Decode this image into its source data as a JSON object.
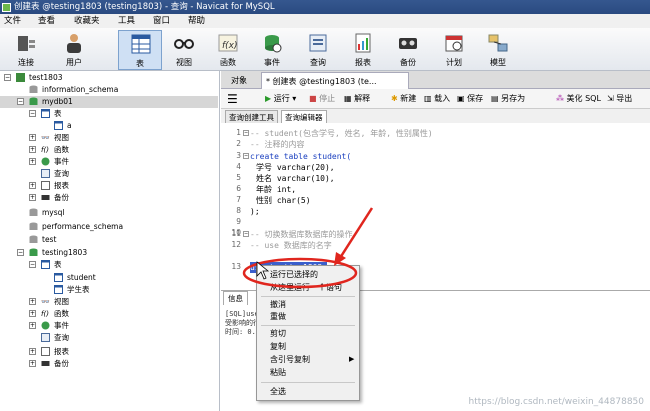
{
  "window": {
    "title": "创建表 @testing1803 (testing1803) - 查询 - Navicat for MySQL"
  },
  "menu": [
    "文件",
    "查看",
    "收藏夹",
    "工具",
    "窗口",
    "帮助"
  ],
  "toolbar": [
    {
      "label": "连接",
      "icon": "connection-icon"
    },
    {
      "label": "用户",
      "icon": "user-icon"
    },
    {
      "label": "表",
      "icon": "table-icon"
    },
    {
      "label": "视图",
      "icon": "view-icon"
    },
    {
      "label": "函数",
      "icon": "function-icon"
    },
    {
      "label": "事件",
      "icon": "event-icon"
    },
    {
      "label": "查询",
      "icon": "query-icon"
    },
    {
      "label": "报表",
      "icon": "report-icon"
    },
    {
      "label": "备份",
      "icon": "backup-icon"
    },
    {
      "label": "计划",
      "icon": "schedule-icon"
    },
    {
      "label": "模型",
      "icon": "model-icon"
    }
  ],
  "tree": [
    {
      "text": "test1803"
    },
    {
      "text": "information_schema"
    },
    {
      "text": "mydb01"
    },
    {
      "text": "表"
    },
    {
      "text": "a"
    },
    {
      "text": "视图"
    },
    {
      "text": "函数"
    },
    {
      "text": "事件"
    },
    {
      "text": "查询"
    },
    {
      "text": "报表"
    },
    {
      "text": "备份"
    },
    {
      "text": "mysql"
    },
    {
      "text": "performance_schema"
    },
    {
      "text": "test"
    },
    {
      "text": "testing1803"
    },
    {
      "text": "表"
    },
    {
      "text": "student"
    },
    {
      "text": "学生表"
    },
    {
      "text": "视图"
    },
    {
      "text": "函数"
    },
    {
      "text": "事件"
    },
    {
      "text": "查询"
    },
    {
      "text": "报表"
    },
    {
      "text": "备份"
    }
  ],
  "tabs": {
    "objects": "对象",
    "query_tab": "* 创建表 @testing1803 (te..."
  },
  "qtools": {
    "run": "运行",
    "stop": "停止",
    "explain": "解释",
    "new": "新建",
    "load": "载入",
    "save": "保存",
    "save_as": "另存为",
    "beautify": "美化 SQL",
    "export": "导出"
  },
  "subtabs": {
    "builder": "查询创建工具",
    "editor": "查询编辑器"
  },
  "code": [
    {
      "n": "1",
      "t": "-- student(包含学号, 姓名, 年龄, 性别属性)"
    },
    {
      "n": "2",
      "t": "-- 注释的内容"
    },
    {
      "n": "3",
      "t": "create table student("
    },
    {
      "n": "4",
      "t": "学号 varchar(20),"
    },
    {
      "n": "5",
      "t": "姓名 varchar(10),"
    },
    {
      "n": "6",
      "t": "年龄 int,"
    },
    {
      "n": "7",
      "t": "性别 char(5)"
    },
    {
      "n": "8",
      "t": ");"
    },
    {
      "n": "9",
      "t": ""
    },
    {
      "n": "10",
      "t": ""
    },
    {
      "n": "11",
      "t": "-- 切换数据库数据库的操作"
    },
    {
      "n": "12",
      "t": "-- use 数据库的名字"
    },
    {
      "n": "13",
      "t": "use testing1803;"
    }
  ],
  "bottom": {
    "tabs": [
      "信息",
      "概况",
      "状态"
    ],
    "lines": [
      "[SQL]use testing1803;",
      "受影响的行: 0",
      "时间: 0.001s"
    ]
  },
  "context_menu": {
    "run_selected": "运行已选择的",
    "run_from_here": "从这里运行一个语句",
    "undo": "撤消",
    "redo": "重做",
    "cut": "剪切",
    "copy": "复制",
    "copy_quoted": "含引号复制",
    "paste": "粘贴",
    "select_all": "全选"
  },
  "watermark": "https://blog.csdn.net/weixin_44878850",
  "colors": {
    "titlebar": "#2a4a80",
    "annotation": "#e0261e",
    "keyword": "#1a3fbf",
    "comment": "#9a9a9a"
  }
}
